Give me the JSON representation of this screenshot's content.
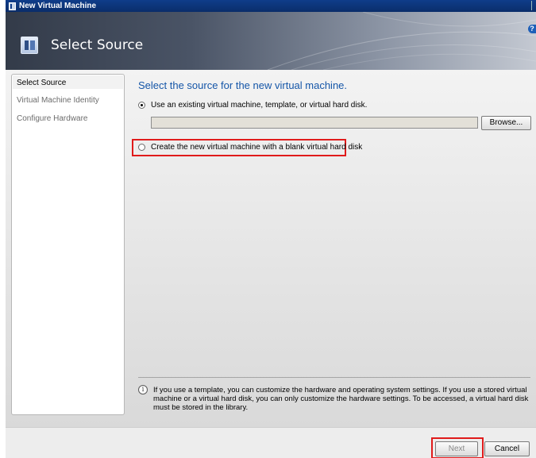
{
  "window": {
    "title": "New Virtual Machine"
  },
  "header": {
    "title": "Select Source",
    "help_glyph": "?"
  },
  "nav": {
    "items": [
      {
        "label": "Select Source",
        "active": true
      },
      {
        "label": "Virtual Machine Identity",
        "active": false
      },
      {
        "label": "Configure Hardware",
        "active": false
      }
    ]
  },
  "main": {
    "heading": "Select the source for the new virtual machine.",
    "option_existing": {
      "label": "Use an existing virtual machine, template, or virtual hard disk.",
      "selected": true
    },
    "path_value": "",
    "browse_label": "Browse...",
    "option_blank": {
      "label": "Create the new virtual machine with a blank virtual hard disk",
      "selected": false
    },
    "info_glyph": "i",
    "info_text": "If you use a template, you can customize the hardware and operating system settings. If you use a stored virtual machine or a virtual hard disk, you can only customize the hardware settings. To be accessed, a virtual hard disk must be stored in the library."
  },
  "footer": {
    "next_label": "Next",
    "cancel_label": "Cancel"
  },
  "colors": {
    "highlight": "#e01b1b",
    "heading": "#1556a8",
    "titlebar": "#0f3d8a"
  },
  "icons": [
    "virtual-machine-app-icon",
    "select-source-icon",
    "help-icon",
    "info-icon"
  ]
}
